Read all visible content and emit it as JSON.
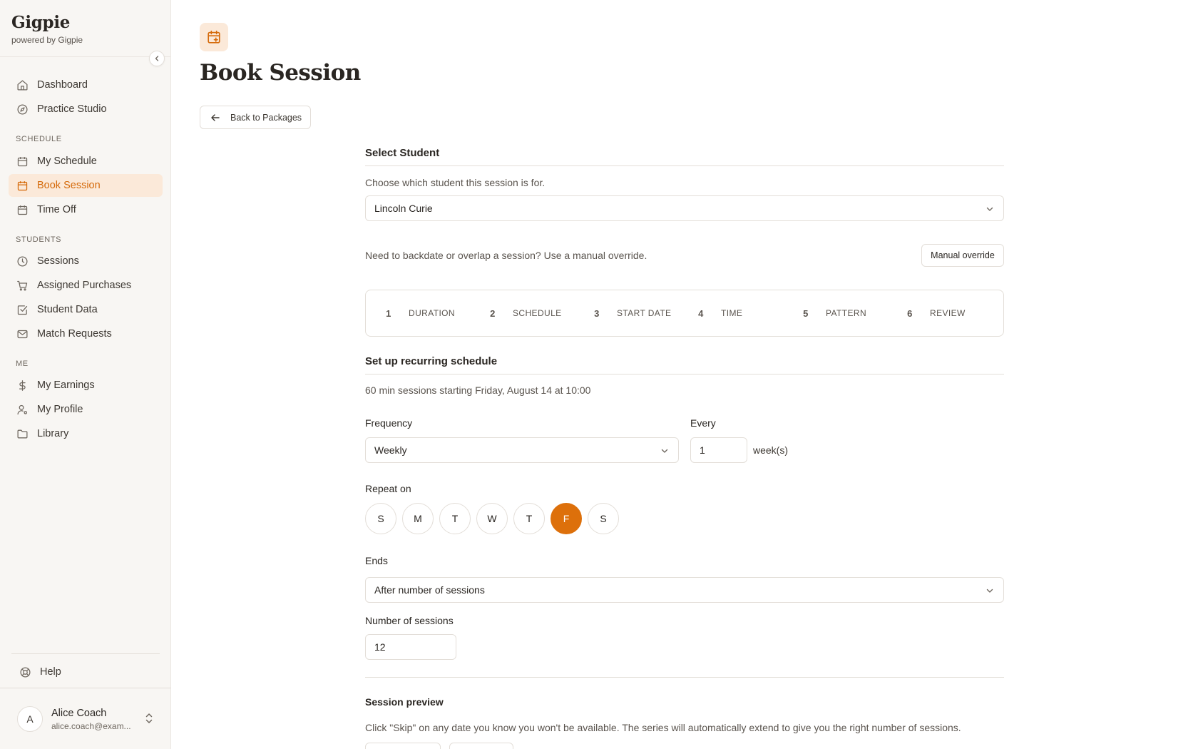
{
  "brand": {
    "name": "Gigpie",
    "sub": "powered by Gigpie"
  },
  "nav": {
    "dashboard": "Dashboard",
    "practice": "Practice Studio",
    "section_schedule": "SCHEDULE",
    "my_schedule": "My Schedule",
    "book_session": "Book Session",
    "time_off": "Time Off",
    "section_students": "STUDENTS",
    "sessions": "Sessions",
    "assigned_purchases": "Assigned Purchases",
    "student_data": "Student Data",
    "match_requests": "Match Requests",
    "section_me": "ME",
    "my_earnings": "My Earnings",
    "my_profile": "My Profile",
    "library": "Library",
    "help": "Help"
  },
  "user": {
    "initial": "A",
    "name": "Alice Coach",
    "email": "alice.coach@exam..."
  },
  "page": {
    "title": "Book Session",
    "back_label": "Back to Packages"
  },
  "student": {
    "title": "Select Student",
    "desc": "Choose which student this session is for.",
    "selected": "Lincoln Curie",
    "override_text": "Need to backdate or overlap a session? Use a manual override.",
    "override_button": "Manual override"
  },
  "steps": [
    {
      "num": "1",
      "label": "DURATION",
      "state": "done"
    },
    {
      "num": "2",
      "label": "SCHEDULE",
      "state": "done"
    },
    {
      "num": "3",
      "label": "START DATE",
      "state": "done"
    },
    {
      "num": "4",
      "label": "TIME",
      "state": "done"
    },
    {
      "num": "5",
      "label": "PATTERN",
      "state": "current"
    },
    {
      "num": "6",
      "label": "REVIEW",
      "state": "todo"
    }
  ],
  "recurring": {
    "title": "Set up recurring schedule",
    "summary": "60 min sessions starting Friday, August 14 at 10:00",
    "frequency_label": "Frequency",
    "frequency_value": "Weekly",
    "every_label": "Every",
    "every_value": "1",
    "every_unit": "week(s)",
    "repeat_label": "Repeat on",
    "days": [
      "S",
      "M",
      "T",
      "W",
      "T",
      "F",
      "S"
    ],
    "selected_day_index": 5,
    "ends_label": "Ends",
    "ends_value": "After number of sessions",
    "count_label": "Number of sessions",
    "count_value": "12"
  },
  "preview": {
    "title": "Session preview",
    "desc": "Click \"Skip\" on any date you know you won't be available. The series will automatically extend to give you the right number of sessions."
  },
  "colors": {
    "accent": "#dd700b",
    "accent_soft": "#fbe9d9",
    "sidebar_bg": "#f8f6f3"
  }
}
